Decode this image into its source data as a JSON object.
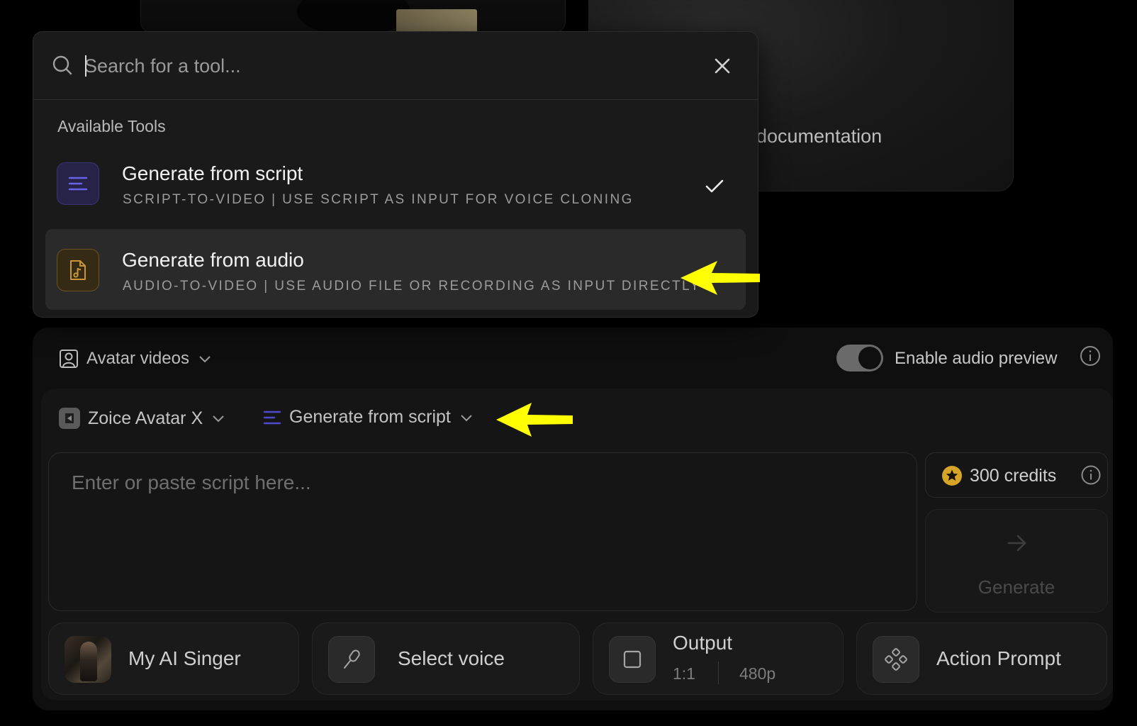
{
  "background": {
    "documentation_text": "documentation"
  },
  "tool_picker": {
    "search": {
      "placeholder": "Search for a tool...",
      "value": ""
    },
    "section_title": "Available Tools",
    "tools": [
      {
        "title": "Generate from script",
        "subtitle": "SCRIPT-TO-VIDEO | USE SCRIPT AS INPUT FOR VOICE CLONING",
        "icon": "script-lines-icon",
        "selected": true
      },
      {
        "title": "Generate from audio",
        "subtitle": "AUDIO-TO-VIDEO | USE AUDIO FILE OR RECORDING AS INPUT DIRECTLY",
        "icon": "audio-file-icon",
        "selected": false,
        "highlighted": true
      }
    ]
  },
  "panel": {
    "category": "Avatar videos",
    "audio_preview": {
      "label": "Enable audio preview",
      "enabled": true
    },
    "model": "Zoice Avatar X",
    "mode": "Generate from script",
    "script": {
      "placeholder": "Enter or paste script here...",
      "value": ""
    },
    "credits": "300 credits",
    "generate_label": "Generate",
    "bottom_bar": {
      "singer": "My AI Singer",
      "voice": "Select voice",
      "output": {
        "title": "Output",
        "ratio": "1:1",
        "resolution": "480p"
      },
      "action_prompt": "Action Prompt"
    }
  },
  "colors": {
    "background": "#000000",
    "dropdown_bg": "#1a1a1a",
    "highlight_row": "#2a2a2a",
    "script_accent": "#5b55d6",
    "audio_accent": "#b8862f",
    "credits_star": "#d6a426",
    "annotation_arrow": "#ffff00"
  }
}
